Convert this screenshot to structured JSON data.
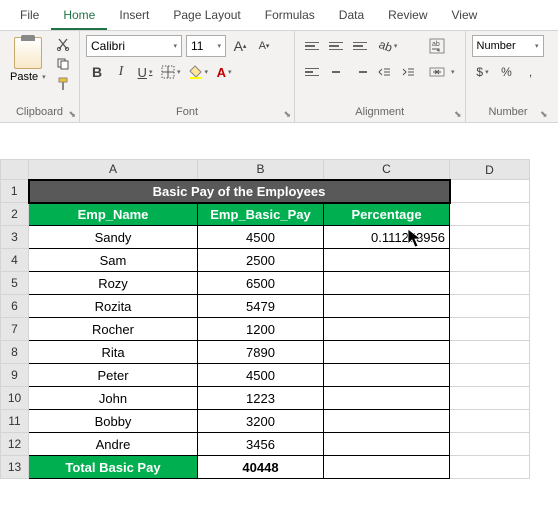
{
  "menu": {
    "file": "File",
    "home": "Home",
    "insert": "Insert",
    "page_layout": "Page Layout",
    "formulas": "Formulas",
    "data": "Data",
    "review": "Review",
    "view": "View"
  },
  "ribbon": {
    "clipboard": {
      "label": "Clipboard",
      "paste": "Paste"
    },
    "font": {
      "label": "Font",
      "name": "Calibri",
      "size": "11",
      "grow": "A",
      "shrink": "A",
      "b": "B",
      "i": "I",
      "u": "U",
      "font_color_letter": "A"
    },
    "alignment": {
      "label": "Alignment",
      "wrap": "ab",
      "merge": ""
    },
    "number": {
      "label": "Number",
      "format": "Number",
      "currency": "$",
      "percent": "%",
      "comma": ","
    }
  },
  "columns": {
    "A": "A",
    "B": "B",
    "C": "C",
    "D": "D"
  },
  "rows": [
    "1",
    "2",
    "3",
    "4",
    "5",
    "6",
    "7",
    "8",
    "9",
    "10",
    "11",
    "12",
    "13"
  ],
  "sheet": {
    "title": "Basic Pay of the Employees",
    "headers": {
      "name": "Emp_Name",
      "pay": "Emp_Basic_Pay",
      "perc": "Percentage"
    },
    "data": [
      {
        "name": "Sandy",
        "pay": "4500",
        "perc": "0.111253956"
      },
      {
        "name": "Sam",
        "pay": "2500",
        "perc": ""
      },
      {
        "name": "Rozy",
        "pay": "6500",
        "perc": ""
      },
      {
        "name": "Rozita",
        "pay": "5479",
        "perc": ""
      },
      {
        "name": "Rocher",
        "pay": "1200",
        "perc": ""
      },
      {
        "name": "Rita",
        "pay": "7890",
        "perc": ""
      },
      {
        "name": "Peter",
        "pay": "4500",
        "perc": ""
      },
      {
        "name": "John",
        "pay": "1223",
        "perc": ""
      },
      {
        "name": "Bobby",
        "pay": "3200",
        "perc": ""
      },
      {
        "name": "Andre",
        "pay": "3456",
        "perc": ""
      }
    ],
    "total_label": "Total Basic Pay",
    "total_value": "40448"
  }
}
